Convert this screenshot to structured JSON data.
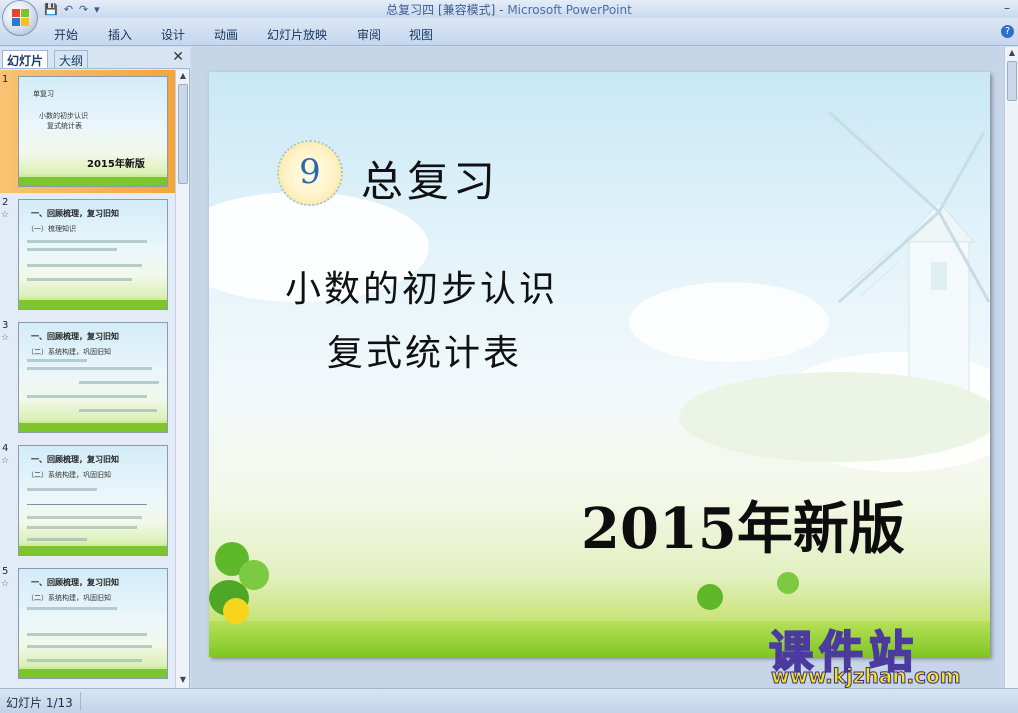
{
  "window": {
    "title": "总复习四 [兼容模式] - ",
    "app_name": "Microsoft PowerPoint",
    "minimize": "–"
  },
  "quick_access": {
    "save": "💾",
    "undo": "↶",
    "redo": "↷",
    "more": "▾"
  },
  "ribbon": {
    "tabs": [
      "开始",
      "插入",
      "设计",
      "动画",
      "幻灯片放映",
      "审阅",
      "视图"
    ],
    "help": "?"
  },
  "left_pane": {
    "tab_slides": "幻灯片",
    "tab_outline": "大纲",
    "close": "✕",
    "thumbnails": [
      {
        "number": "1",
        "line1": "单复习",
        "line2": "小数的初步认识",
        "line3": "复式统计表",
        "big": "2015年新版"
      },
      {
        "number": "2",
        "heading": "一、回顾梳理，复习旧知",
        "sub": "（一）梳理知识"
      },
      {
        "number": "3",
        "heading": "一、回顾梳理，复习旧知",
        "sub": "（二）系统构建，巩固旧知"
      },
      {
        "number": "4",
        "heading": "一、回顾梳理，复习旧知",
        "sub": "（二）系统构建，巩固旧知"
      },
      {
        "number": "5",
        "heading": "一、回顾梳理，复习旧知",
        "sub": "（二）系统构建，巩固旧知"
      }
    ]
  },
  "slide": {
    "badge_number": "9",
    "title": "总复习",
    "subtitle_line1": "小数的初步认识",
    "subtitle_line2": "复式统计表",
    "edition": "2015年新版"
  },
  "watermark": {
    "top": "课件站",
    "bottom": "www.kjzhan.com"
  },
  "status": {
    "slide_counter": "幻灯片 1/13"
  },
  "colors": {
    "selected_thumb": "#f5a43a",
    "accent": "#2a6aa8"
  }
}
